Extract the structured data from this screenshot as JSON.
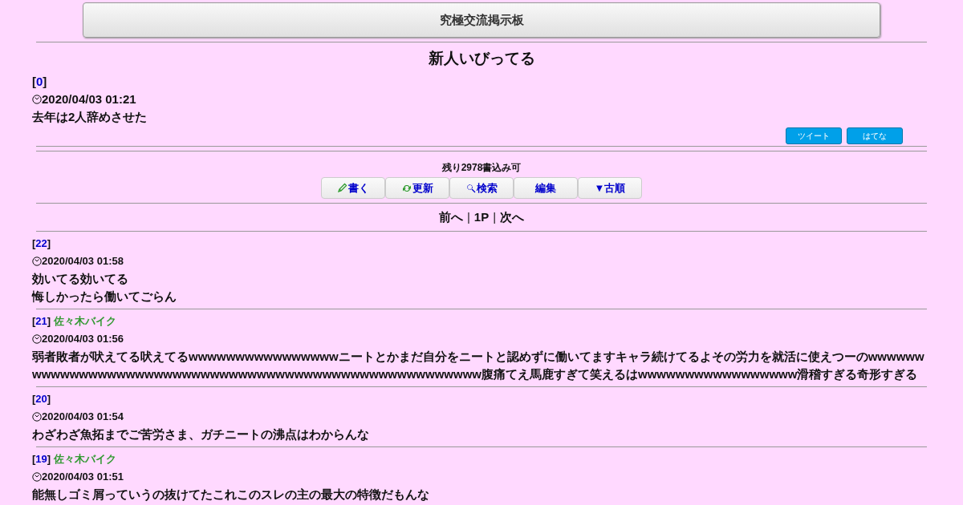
{
  "board": {
    "title": "究極交流掲示板"
  },
  "thread": {
    "title": "新人いびってる",
    "open": "[",
    "number": "0",
    "close": "]",
    "date": "2020/04/03 01:21",
    "lines": [
      "去年は2人辞めさせた"
    ]
  },
  "share_buttons": [
    "ツイート",
    "はてな"
  ],
  "remaining": "残り2978書込み可",
  "actions": [
    {
      "label": "書く",
      "kind": "pencil"
    },
    {
      "label": "更新",
      "kind": "refresh"
    },
    {
      "label": "検索",
      "kind": "search"
    },
    {
      "label": "編集",
      "kind": "plain"
    },
    {
      "label": "▼古順",
      "kind": "plain"
    }
  ],
  "pager": [
    {
      "kind": "link",
      "text": "前へ"
    },
    {
      "kind": "separator",
      "text": "|"
    },
    {
      "kind": "link",
      "text": "1P"
    },
    {
      "kind": "separator",
      "text": "|"
    },
    {
      "kind": "link",
      "text": "次へ"
    }
  ],
  "posts": [
    {
      "open": "[",
      "number": "22",
      "close": "]",
      "date": "2020/04/03 01:58",
      "lines": [
        "効いてる効いてる",
        "悔しかったら働いてごらん"
      ]
    },
    {
      "open": "[",
      "number": "21",
      "close": "]",
      "author": "佐々木バイク",
      "date": "2020/04/03 01:56",
      "lines": [
        "弱者敗者が吠えてる吠えてるwwwwwwwwwwwwwwwwニートとかまだ自分をニートと認めずに働いてますキャラ続けてるよその労力を就活に使えつーのwwwwwwwwwwwwwwwwwwwwwwwwwwwwwwwwwwwwwwwwwwwwwwwwwwwwww腹痛てえ馬鹿すぎて笑えるはwwwwwwwwwwwwwwwww滑稽すぎる奇形すぎる"
      ]
    },
    {
      "open": "[",
      "number": "20",
      "close": "]",
      "date": "2020/04/03 01:54",
      "lines": [
        "わざわざ魚拓までご苦労さま、ガチニートの沸点はわからんな"
      ]
    },
    {
      "open": "[",
      "number": "19",
      "close": "]",
      "author": "佐々木バイク",
      "date": "2020/04/03 01:51",
      "lines": [
        "能無しゴミ屑っていうの抜けてたこれこのスレの主の最大の特徴だもんな"
      ]
    }
  ]
}
